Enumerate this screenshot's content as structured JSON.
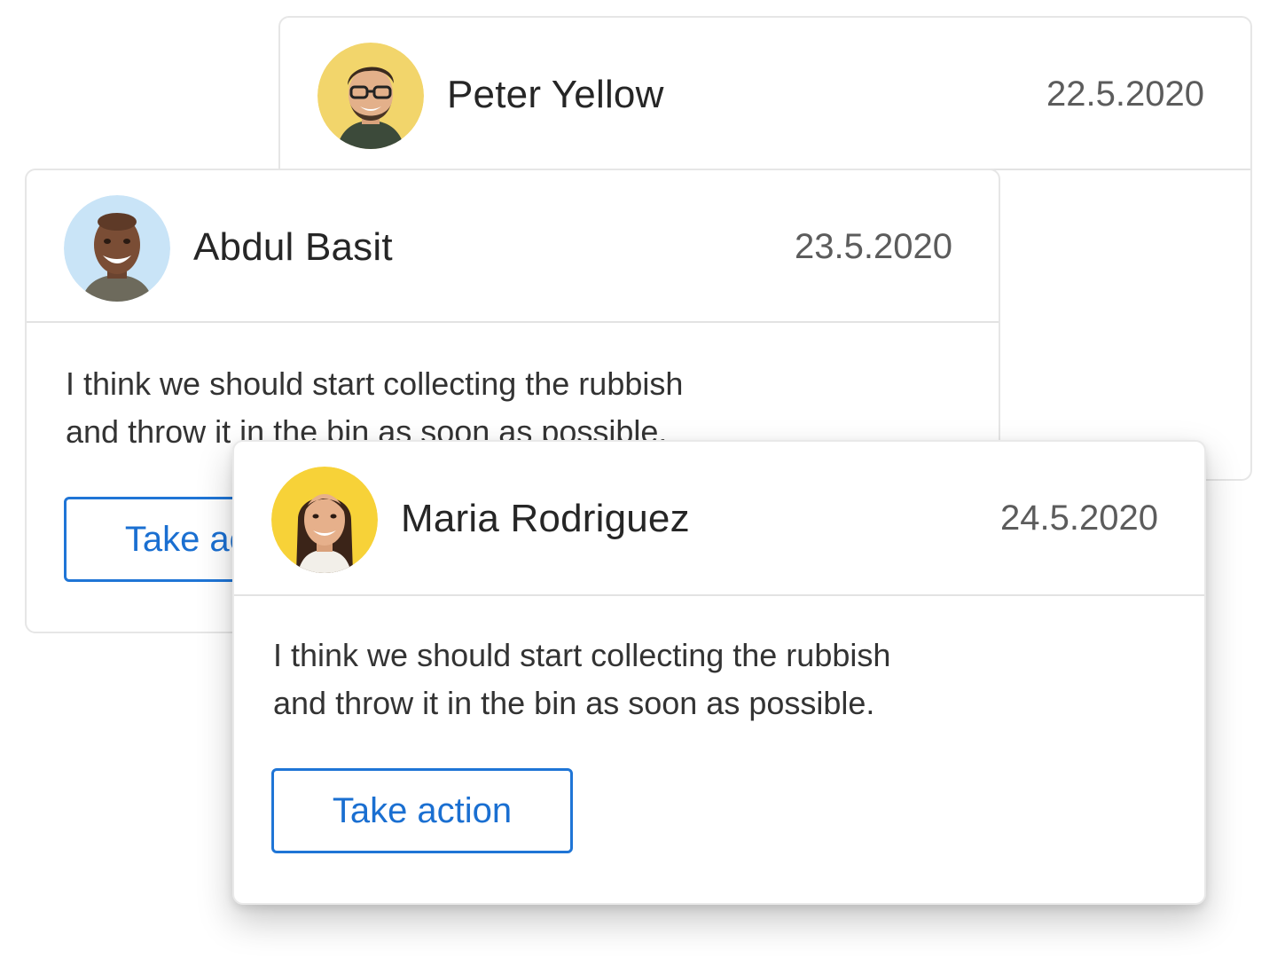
{
  "cards": [
    {
      "name": "Peter Yellow",
      "date": "22.5.2020",
      "avatar_bg": "#f2d56b"
    },
    {
      "name": "Abdul Basit",
      "date": "23.5.2020",
      "avatar_bg": "#c9e4f7",
      "message_line1": "I think we should start collecting the rubbish",
      "message_line2": "and throw it in the bin as soon as possible.",
      "action_label": "Take action"
    },
    {
      "name": "Maria Rodriguez",
      "date": "24.5.2020",
      "avatar_bg": "#f7d238",
      "message_line1": "I think we should start collecting the rubbish",
      "message_line2": "and throw it in the bin as soon as possible.",
      "action_label": "Take action"
    }
  ],
  "colors": {
    "accent": "#1f75d6",
    "name_text": "#262626",
    "date_text": "#5c5c5c",
    "divider": "#e3e3e3"
  }
}
